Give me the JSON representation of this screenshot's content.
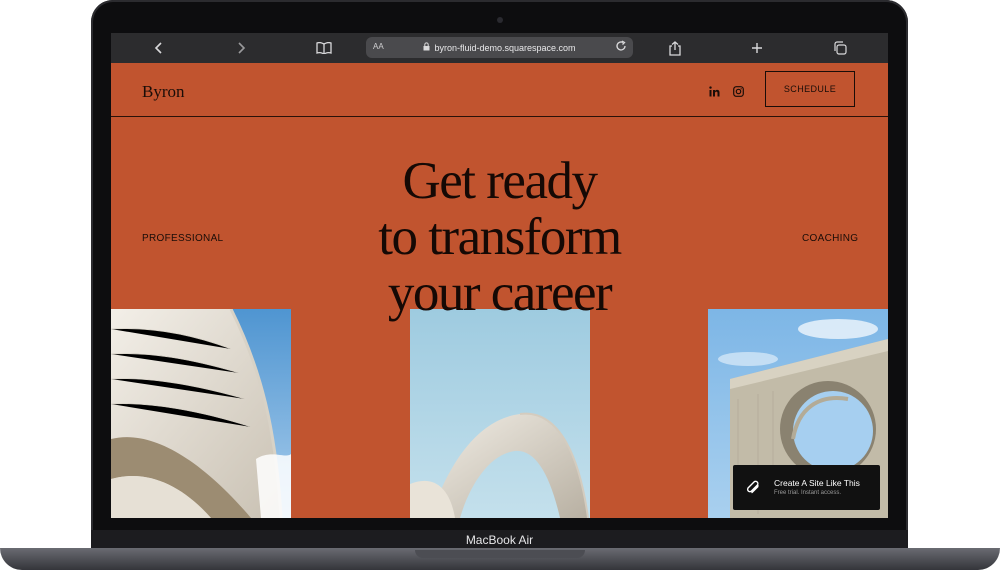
{
  "device": {
    "brand": "MacBook Air"
  },
  "browser": {
    "text_size_label": "AA",
    "url": "byron-fluid-demo.squarespace.com"
  },
  "site": {
    "logo": "Byron",
    "schedule_label": "SCHEDULE",
    "headline": [
      "Get ready",
      "to transform",
      "your career"
    ],
    "left_label": "PROFESSIONAL",
    "right_label": "COACHING",
    "colors": {
      "background": "#c1542f",
      "text": "#1a0d08"
    }
  },
  "badge": {
    "title": "Create A Site Like This",
    "subtitle": "Free trial. Instant access."
  }
}
